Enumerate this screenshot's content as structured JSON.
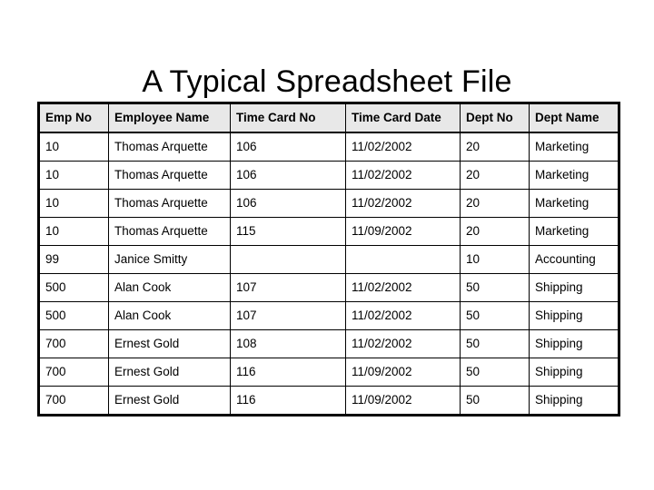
{
  "slide": {
    "title": "A Typical Spreadsheet File",
    "background_color": "#ffffff",
    "text_color": "#000000"
  },
  "table": {
    "header_background_color": "#e8e8e8",
    "body_background_color": "#ffffff",
    "border_color": "#000000",
    "columns": [
      {
        "key": "emp_no",
        "label": "Emp No"
      },
      {
        "key": "emp_name",
        "label": "Employee Name"
      },
      {
        "key": "card_no",
        "label": "Time Card No"
      },
      {
        "key": "card_date",
        "label": "Time Card Date"
      },
      {
        "key": "dept_no",
        "label": "Dept No"
      },
      {
        "key": "dept_name",
        "label": "Dept Name"
      }
    ],
    "rows": [
      {
        "emp_no": "10",
        "emp_name": "Thomas Arquette",
        "card_no": "106",
        "card_date": "11/02/2002",
        "dept_no": "20",
        "dept_name": "Marketing"
      },
      {
        "emp_no": "10",
        "emp_name": "Thomas Arquette",
        "card_no": "106",
        "card_date": "11/02/2002",
        "dept_no": "20",
        "dept_name": "Marketing"
      },
      {
        "emp_no": "10",
        "emp_name": "Thomas Arquette",
        "card_no": "106",
        "card_date": "11/02/2002",
        "dept_no": "20",
        "dept_name": "Marketing"
      },
      {
        "emp_no": "10",
        "emp_name": "Thomas Arquette",
        "card_no": "115",
        "card_date": "11/09/2002",
        "dept_no": "20",
        "dept_name": "Marketing"
      },
      {
        "emp_no": "99",
        "emp_name": "Janice Smitty",
        "card_no": "",
        "card_date": "",
        "dept_no": "10",
        "dept_name": "Accounting"
      },
      {
        "emp_no": "500",
        "emp_name": "Alan Cook",
        "card_no": "107",
        "card_date": "11/02/2002",
        "dept_no": "50",
        "dept_name": "Shipping"
      },
      {
        "emp_no": "500",
        "emp_name": "Alan Cook",
        "card_no": "107",
        "card_date": "11/02/2002",
        "dept_no": "50",
        "dept_name": "Shipping"
      },
      {
        "emp_no": "700",
        "emp_name": "Ernest Gold",
        "card_no": "108",
        "card_date": "11/02/2002",
        "dept_no": "50",
        "dept_name": "Shipping"
      },
      {
        "emp_no": "700",
        "emp_name": "Ernest Gold",
        "card_no": "116",
        "card_date": "11/09/2002",
        "dept_no": "50",
        "dept_name": "Shipping"
      },
      {
        "emp_no": "700",
        "emp_name": "Ernest Gold",
        "card_no": "116",
        "card_date": "11/09/2002",
        "dept_no": "50",
        "dept_name": "Shipping"
      }
    ]
  }
}
